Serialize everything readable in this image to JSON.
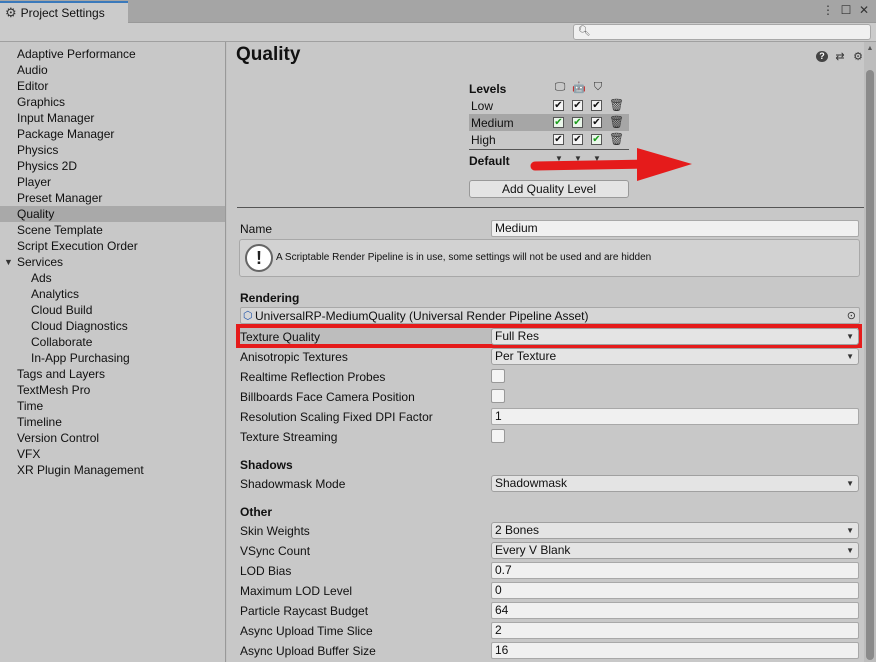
{
  "window": {
    "tab_title": "Project Settings",
    "tab_icon": "gear-icon"
  },
  "search": {
    "placeholder": ""
  },
  "sidebar": {
    "items": [
      {
        "label": "Adaptive Performance",
        "sub": false
      },
      {
        "label": "Audio",
        "sub": false
      },
      {
        "label": "Editor",
        "sub": false
      },
      {
        "label": "Graphics",
        "sub": false
      },
      {
        "label": "Input Manager",
        "sub": false
      },
      {
        "label": "Package Manager",
        "sub": false
      },
      {
        "label": "Physics",
        "sub": false
      },
      {
        "label": "Physics 2D",
        "sub": false
      },
      {
        "label": "Player",
        "sub": false
      },
      {
        "label": "Preset Manager",
        "sub": false
      },
      {
        "label": "Quality",
        "sub": false,
        "selected": true
      },
      {
        "label": "Scene Template",
        "sub": false
      },
      {
        "label": "Script Execution Order",
        "sub": false
      },
      {
        "label": "Services",
        "sub": false,
        "expanded": true
      },
      {
        "label": "Ads",
        "sub": true
      },
      {
        "label": "Analytics",
        "sub": true
      },
      {
        "label": "Cloud Build",
        "sub": true
      },
      {
        "label": "Cloud Diagnostics",
        "sub": true
      },
      {
        "label": "Collaborate",
        "sub": true
      },
      {
        "label": "In-App Purchasing",
        "sub": true
      },
      {
        "label": "Tags and Layers",
        "sub": false
      },
      {
        "label": "TextMesh Pro",
        "sub": false
      },
      {
        "label": "Time",
        "sub": false
      },
      {
        "label": "Timeline",
        "sub": false
      },
      {
        "label": "Version Control",
        "sub": false
      },
      {
        "label": "VFX",
        "sub": false
      },
      {
        "label": "XR Plugin Management",
        "sub": false
      }
    ]
  },
  "main": {
    "title": "Quality",
    "levels": {
      "header": "Levels",
      "platforms": [
        "desktop-icon",
        "android-icon",
        "html5-icon"
      ],
      "rows": [
        {
          "name": "Low",
          "checks": [
            true,
            true,
            true
          ],
          "green": [
            false,
            false,
            false
          ],
          "selected": false
        },
        {
          "name": "Medium",
          "checks": [
            true,
            true,
            true
          ],
          "green": [
            true,
            true,
            false
          ],
          "selected": true
        },
        {
          "name": "High",
          "checks": [
            true,
            true,
            true
          ],
          "green": [
            false,
            false,
            true
          ],
          "selected": false
        }
      ],
      "default_label": "Default"
    },
    "add_level_label": "Add Quality Level",
    "name_label": "Name",
    "name_value": "Medium",
    "help_message": "A Scriptable Render Pipeline is in use, some settings will not be used and are hidden",
    "rendering_header": "Rendering",
    "render_asset": "UniversalRP-MediumQuality (Universal Render Pipeline Asset)",
    "rendering": [
      {
        "label": "Texture Quality",
        "type": "dropdown",
        "value": "Full Res"
      },
      {
        "label": "Anisotropic Textures",
        "type": "dropdown",
        "value": "Per Texture"
      },
      {
        "label": "Realtime Reflection Probes",
        "type": "checkbox",
        "value": ""
      },
      {
        "label": "Billboards Face Camera Position",
        "type": "checkbox",
        "value": ""
      },
      {
        "label": "Resolution Scaling Fixed DPI Factor",
        "type": "field",
        "value": "1"
      },
      {
        "label": "Texture Streaming",
        "type": "checkbox",
        "value": ""
      }
    ],
    "shadows_header": "Shadows",
    "shadows": [
      {
        "label": "Shadowmask Mode",
        "type": "dropdown",
        "value": "Shadowmask"
      }
    ],
    "other_header": "Other",
    "other": [
      {
        "label": "Skin Weights",
        "type": "dropdown",
        "value": "2 Bones"
      },
      {
        "label": "VSync Count",
        "type": "dropdown",
        "value": "Every V Blank"
      },
      {
        "label": "LOD Bias",
        "type": "field",
        "value": "0.7"
      },
      {
        "label": "Maximum LOD Level",
        "type": "field",
        "value": "0"
      },
      {
        "label": "Particle Raycast Budget",
        "type": "field",
        "value": "64"
      },
      {
        "label": "Async Upload Time Slice",
        "type": "field",
        "value": "2"
      },
      {
        "label": "Async Upload Buffer Size",
        "type": "field",
        "value": "16"
      }
    ]
  },
  "annotation_colors": {
    "arrow": "#e51b1b",
    "highlight": "#e51b1b"
  }
}
